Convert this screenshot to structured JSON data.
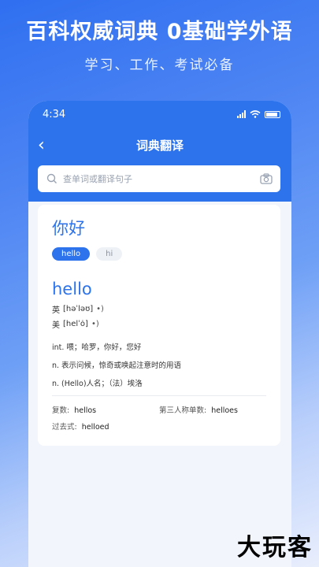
{
  "promo": {
    "title": "百科权威词典 0基础学外语",
    "subtitle": "学习、工作、考试必备"
  },
  "status_bar": {
    "time": "4:34"
  },
  "nav": {
    "title": "词典翻译"
  },
  "search": {
    "placeholder": "查单词或翻译句子"
  },
  "result": {
    "query": "你好",
    "chips": [
      "hello",
      "hi"
    ],
    "word": "hello",
    "phonetics": [
      {
        "label": "英",
        "ipa": "[həˈləʊ]",
        "audio": "•)"
      },
      {
        "label": "美",
        "ipa": "[helˈȯ]",
        "audio": "•)"
      }
    ],
    "definitions": [
      "int. 喂；哈罗，你好，您好",
      "n. 表示问候，惊奇或唤起注意时的用语",
      "n. (Hello)人名；（法）埃洛"
    ],
    "forms": [
      {
        "label": "复数:",
        "value": "hellos"
      },
      {
        "label": "第三人称单数:",
        "value": "helloes"
      },
      {
        "label": "过去式:",
        "value": "helloed"
      }
    ]
  },
  "watermark": "大玩客",
  "colors": {
    "accent": "#2c73ec"
  }
}
